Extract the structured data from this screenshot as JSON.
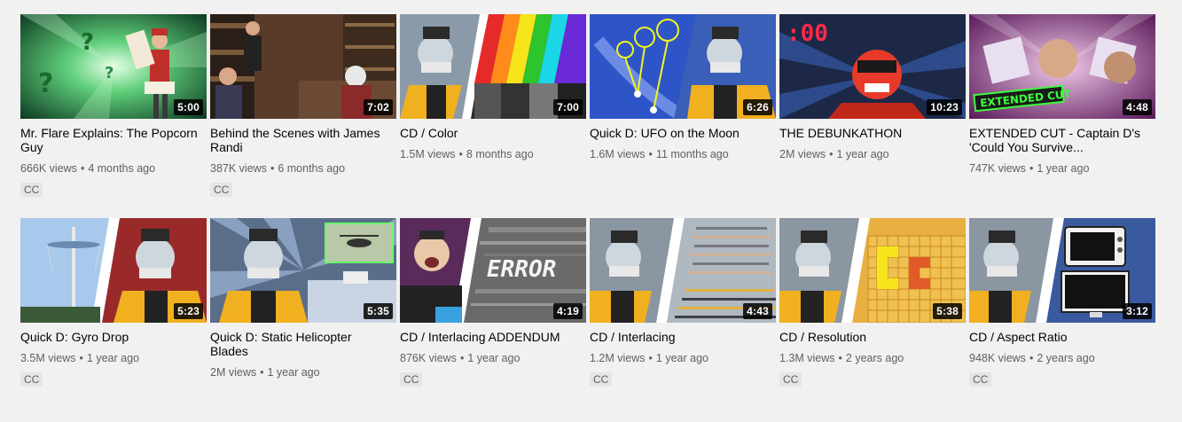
{
  "videos": [
    {
      "title": "Mr. Flare Explains: The Popcorn Guy",
      "views": "666K views",
      "age": "4 months ago",
      "duration": "5:00",
      "badge": "CC",
      "thumb_icon": "popcorn-guy-thumbnail"
    },
    {
      "title": "Behind the Scenes with James Randi",
      "views": "387K views",
      "age": "6 months ago",
      "duration": "7:02",
      "badge": "CC",
      "thumb_icon": "behind-the-scenes-thumbnail"
    },
    {
      "title": "CD / Color",
      "views": "1.5M views",
      "age": "8 months ago",
      "duration": "7:00",
      "badge": "",
      "thumb_icon": "color-stripes-thumbnail"
    },
    {
      "title": "Quick D: UFO on the Moon",
      "views": "1.6M views",
      "age": "11 months ago",
      "duration": "6:26",
      "badge": "",
      "thumb_icon": "ufo-moon-thumbnail"
    },
    {
      "title": "THE DEBUNKATHON",
      "views": "2M views",
      "age": "1 year ago",
      "duration": "10:23",
      "badge": "",
      "thumb_icon": "debunkathon-thumbnail"
    },
    {
      "title": "EXTENDED CUT - Captain D's 'Could You Survive...",
      "views": "747K views",
      "age": "1 year ago",
      "duration": "4:48",
      "badge": "",
      "thumb_icon": "extended-cut-thumbnail"
    },
    {
      "title": "Quick D: Gyro Drop",
      "views": "3.5M views",
      "age": "1 year ago",
      "duration": "5:23",
      "badge": "CC",
      "thumb_icon": "gyro-drop-thumbnail"
    },
    {
      "title": "Quick D: Static Helicopter Blades",
      "views": "2M views",
      "age": "1 year ago",
      "duration": "5:35",
      "badge": "",
      "thumb_icon": "helicopter-thumbnail"
    },
    {
      "title": "CD / Interlacing ADDENDUM",
      "views": "876K views",
      "age": "1 year ago",
      "duration": "4:19",
      "badge": "CC",
      "thumb_icon": "error-static-thumbnail"
    },
    {
      "title": "CD / Interlacing",
      "views": "1.2M views",
      "age": "1 year ago",
      "duration": "4:43",
      "badge": "CC",
      "thumb_icon": "interlacing-thumbnail"
    },
    {
      "title": "CD / Resolution",
      "views": "1.3M views",
      "age": "2 years ago",
      "duration": "5:38",
      "badge": "CC",
      "thumb_icon": "pixel-grid-thumbnail"
    },
    {
      "title": "CD / Aspect Ratio",
      "views": "948K views",
      "age": "2 years ago",
      "duration": "3:12",
      "badge": "CC",
      "thumb_icon": "tv-screens-thumbnail"
    }
  ],
  "thumb_text": {
    "error": "ERROR",
    "extended": "EXTENDED CUT",
    "counter": ":00"
  },
  "colors": {
    "background": "#f1f1f1",
    "meta_text": "#606060",
    "title_text": "#030303",
    "badge_bg": "#e5e5e5",
    "duration_bg": "#000000"
  }
}
